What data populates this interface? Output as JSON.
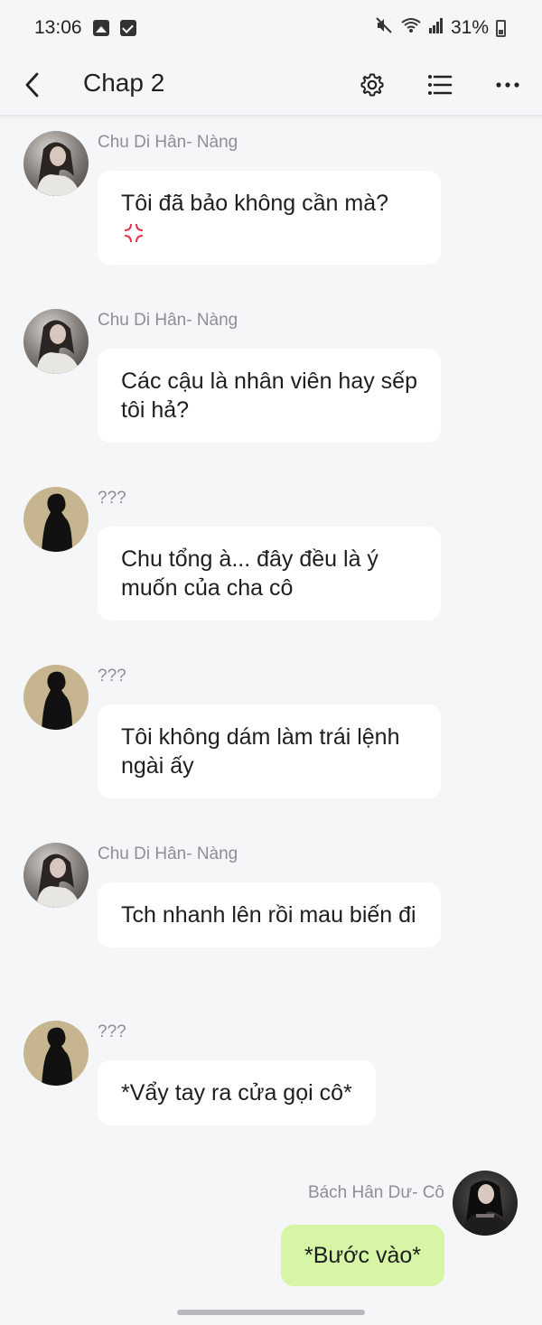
{
  "status_bar": {
    "time": "13:06",
    "battery": "31%",
    "icons": [
      "image-icon",
      "check-icon",
      "mute-icon",
      "wifi-icon",
      "signal-icon",
      "battery-icon"
    ]
  },
  "app_bar": {
    "title": "Chap 2",
    "icons": [
      "back-icon",
      "gear-icon",
      "list-icon",
      "more-icon"
    ]
  },
  "messages": [
    {
      "sender": "Chu Di Hân- Nàng",
      "text": "Tôi đã bảo không cần mà?",
      "emoji": "anger-icon"
    },
    {
      "sender": "Chu Di Hân- Nàng",
      "text": "Các cậu là nhân viên hay sếp tôi hả?"
    },
    {
      "sender": "???",
      "text": "Chu tổng à... đây đều là ý muốn của cha cô"
    },
    {
      "sender": "???",
      "text": "Tôi không dám làm trái lệnh ngài ấy"
    },
    {
      "sender": "Chu Di Hân- Nàng",
      "text": "Tch nhanh lên rồi mau biến đi"
    },
    {
      "sender": "???",
      "text": "*Vẩy tay ra cửa gọi cô*"
    }
  ],
  "own_message": {
    "sender": "Bách Hân Dư- Cô",
    "text": "*Bước vào*"
  },
  "colors": {
    "background": "#f5f6f8",
    "bubble": "#ffffff",
    "own_bubble": "#d6f5a6",
    "sender": "#8c8f94"
  }
}
